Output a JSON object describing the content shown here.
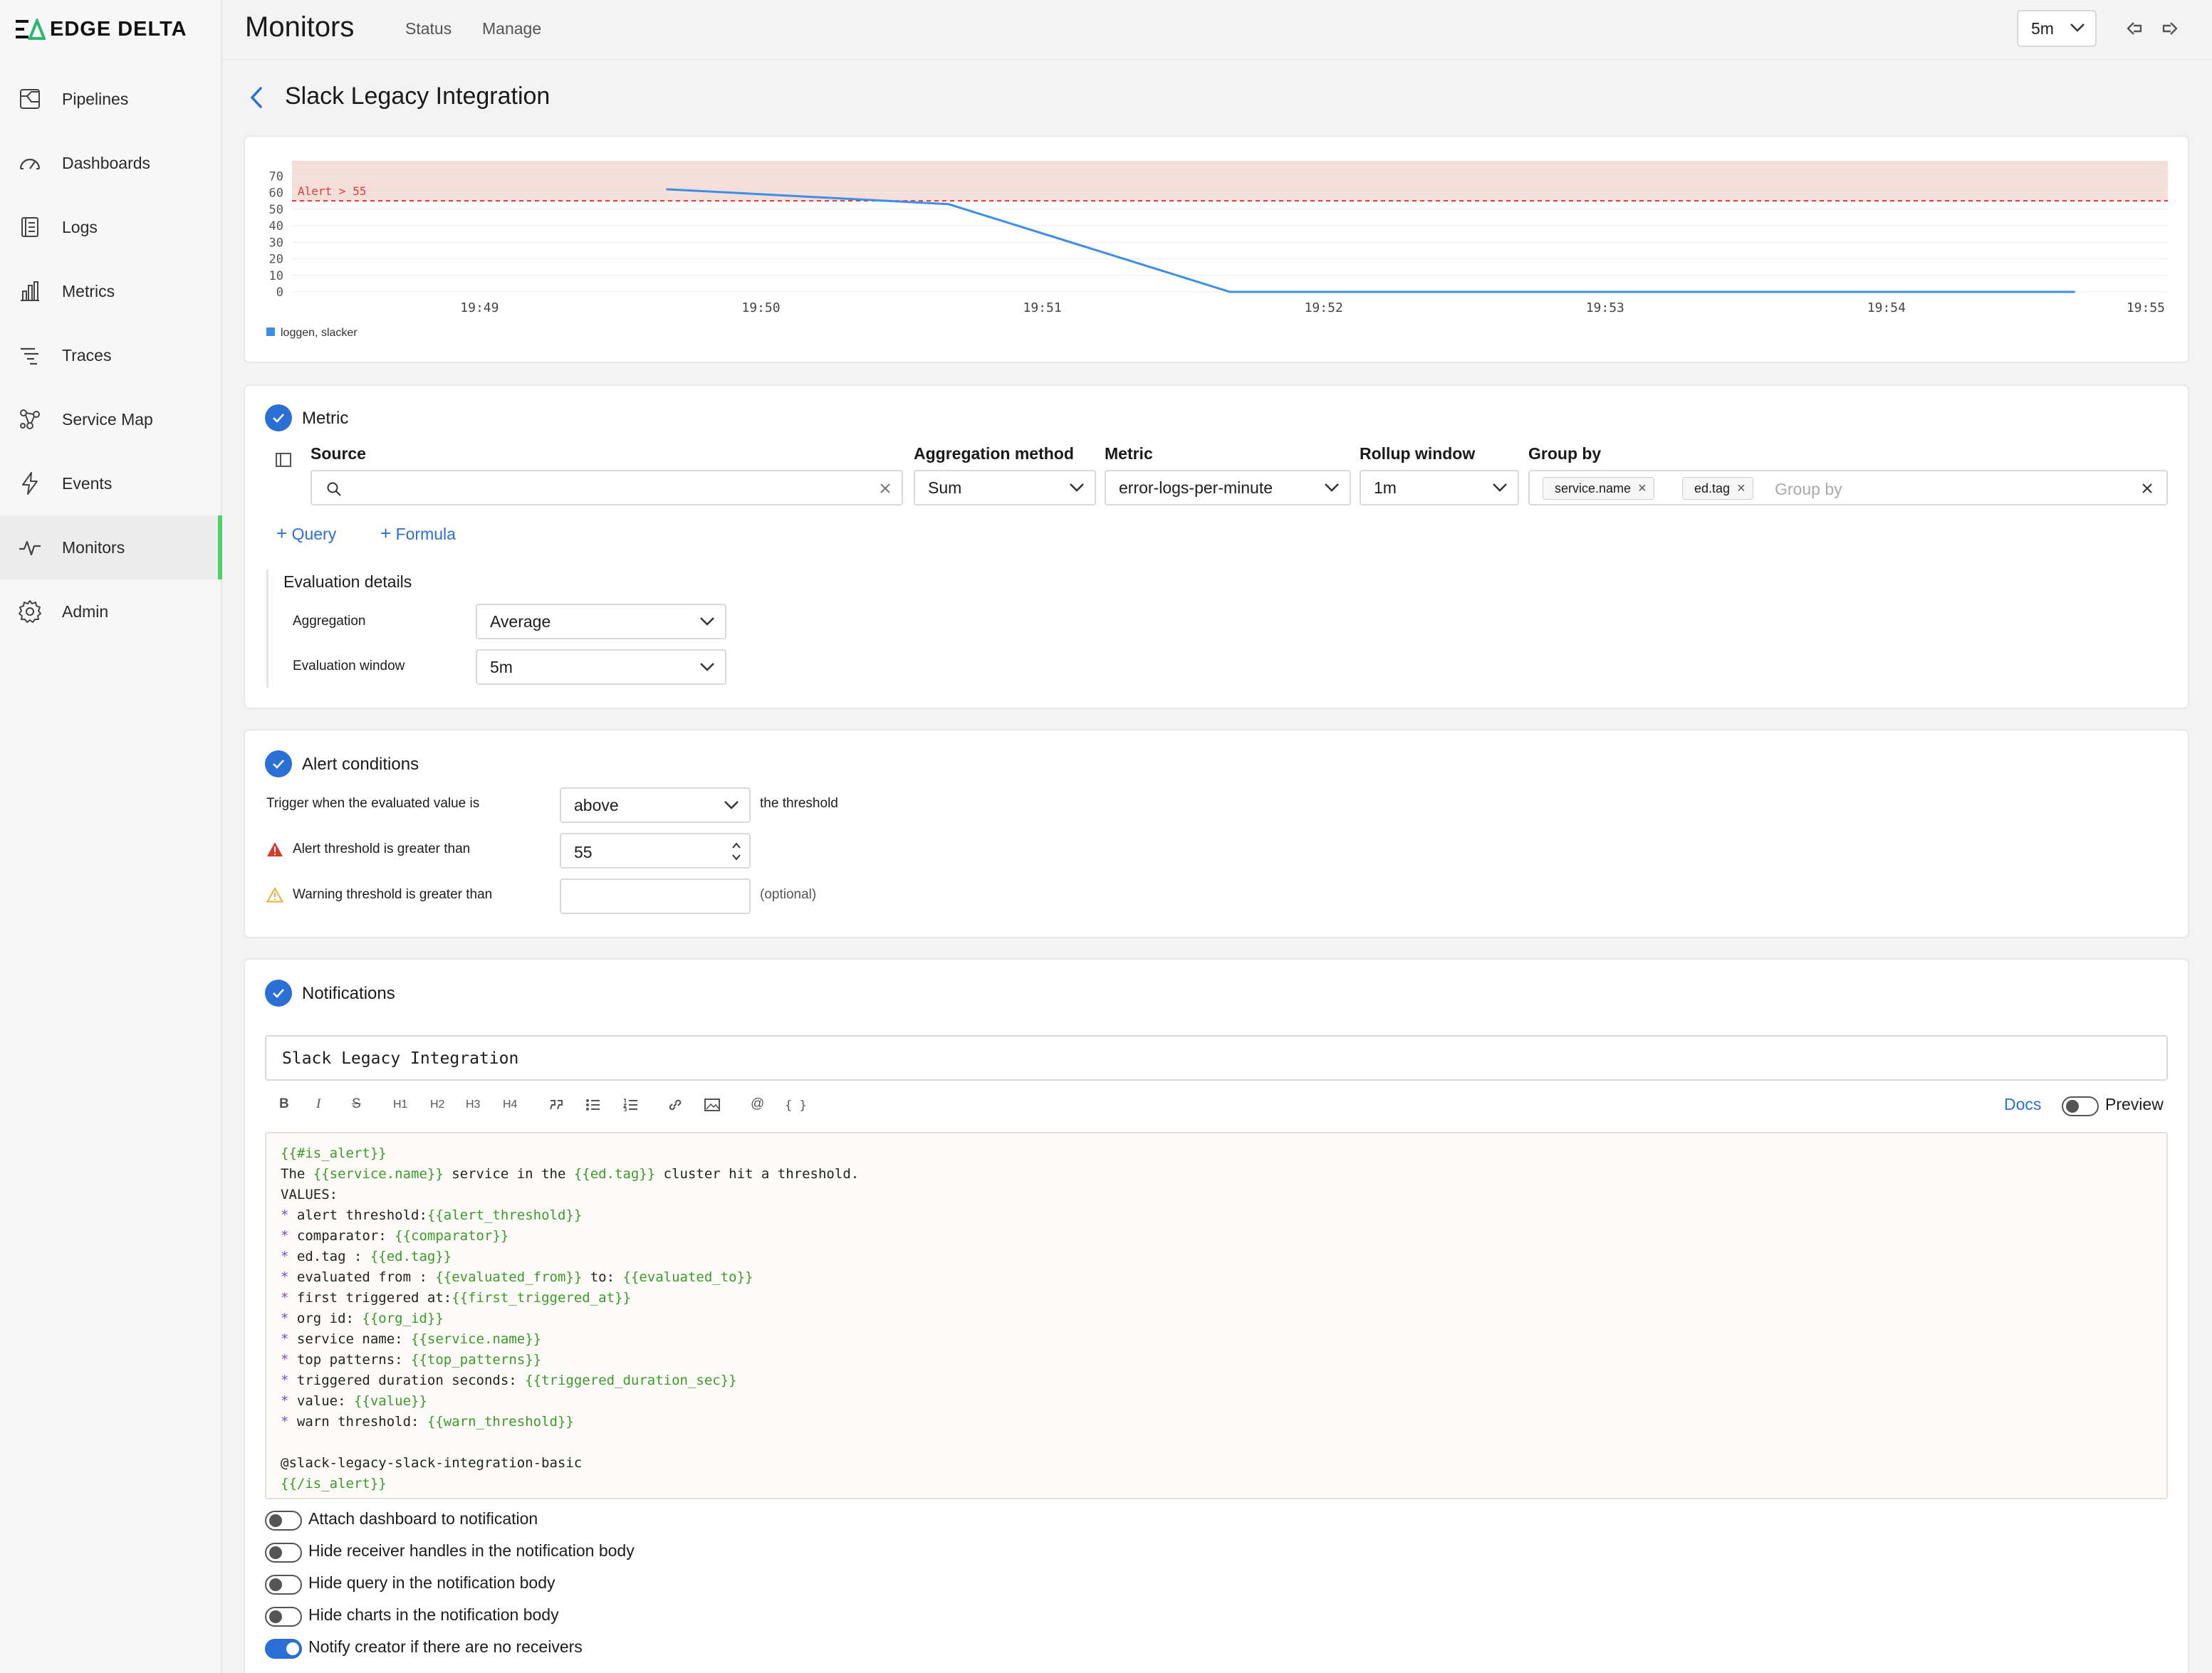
{
  "logo": {
    "text": "EDGE DELTA"
  },
  "sidebar": {
    "items": [
      {
        "label": "Pipelines",
        "icon": "pipelines-icon"
      },
      {
        "label": "Dashboards",
        "icon": "dashboards-icon"
      },
      {
        "label": "Logs",
        "icon": "logs-icon"
      },
      {
        "label": "Metrics",
        "icon": "metrics-icon"
      },
      {
        "label": "Traces",
        "icon": "traces-icon"
      },
      {
        "label": "Service Map",
        "icon": "service-map-icon"
      },
      {
        "label": "Events",
        "icon": "events-icon"
      },
      {
        "label": "Monitors",
        "icon": "monitors-icon",
        "active": true
      },
      {
        "label": "Admin",
        "icon": "admin-icon"
      }
    ],
    "accent": "#4fd26b"
  },
  "header": {
    "title": "Monitors",
    "tabs": [
      "Status",
      "Manage"
    ],
    "time_range": "5m"
  },
  "monitor": {
    "name": "Slack Legacy Integration"
  },
  "chart_data": {
    "type": "line",
    "x": [
      "19:48:40",
      "19:49:40",
      "19:50:40",
      "19:51:40",
      "19:52:40",
      "19:53:40",
      "19:54:40"
    ],
    "x_ticks": [
      "19:49",
      "19:50",
      "19:51",
      "19:52",
      "19:53",
      "19:54",
      "19:55"
    ],
    "series": [
      {
        "name": "loggen, slacker",
        "values": [
          null,
          62,
          53,
          0,
          0,
          0,
          0
        ],
        "color": "#3d8fe6"
      }
    ],
    "ylim": [
      0,
      80
    ],
    "y_ticks": [
      0,
      10,
      20,
      30,
      40,
      50,
      60,
      70
    ],
    "threshold": {
      "value": 55,
      "label": "Alert > 55",
      "color": "#d93b3b",
      "band_color": "#f5ddd8"
    },
    "grid": true,
    "legend": "bottom-left"
  },
  "metric": {
    "title": "Metric",
    "source_label": "Source",
    "source_value": "",
    "aggregation_method_label": "Aggregation method",
    "aggregation_method": "Sum",
    "metric_label": "Metric",
    "metric": "error-logs-per-minute",
    "rollup_label": "Rollup window",
    "rollup": "1m",
    "group_by_label": "Group by",
    "group_by_chips": [
      "service.name",
      "ed.tag"
    ],
    "group_by_placeholder": "Group by",
    "add_query": "Query",
    "add_formula": "Formula",
    "eval_title": "Evaluation details",
    "eval_aggregation_label": "Aggregation",
    "eval_aggregation": "Average",
    "eval_window_label": "Evaluation window",
    "eval_window": "5m"
  },
  "alert": {
    "title": "Alert conditions",
    "trigger_label": "Trigger when the evaluated value is",
    "trigger_value": "above",
    "trigger_suffix": "the threshold",
    "alert_label": "Alert threshold is greater than",
    "alert_value": "55",
    "warn_label": "Warning threshold is greater than",
    "warn_value": "",
    "warn_suffix": "(optional)"
  },
  "notifications": {
    "title": "Notifications",
    "subject": "Slack Legacy Integration",
    "toolbar": [
      "B",
      "I",
      "S",
      "H1",
      "H2",
      "H3",
      "H4",
      "quote",
      "bullet-list",
      "numbered-list",
      "link",
      "image",
      "@",
      "{ }"
    ],
    "docs": "Docs",
    "preview": "Preview",
    "body_lines": [
      [
        [
          "t",
          "{{#is_alert}}"
        ]
      ],
      [
        [
          "p",
          "The "
        ],
        [
          "t",
          "{{service.name}}"
        ],
        [
          "p",
          " service in the "
        ],
        [
          "t",
          "{{ed.tag}}"
        ],
        [
          "p",
          " cluster hit a threshold."
        ]
      ],
      [
        [
          "p",
          "VALUES:"
        ]
      ],
      [
        [
          "b",
          "* "
        ],
        [
          "p",
          "alert threshold:"
        ],
        [
          "t",
          "{{alert_threshold}}"
        ]
      ],
      [
        [
          "b",
          "* "
        ],
        [
          "p",
          "comparator: "
        ],
        [
          "t",
          "{{comparator}}"
        ]
      ],
      [
        [
          "b",
          "* "
        ],
        [
          "p",
          "ed.tag : "
        ],
        [
          "t",
          "{{ed.tag}}"
        ]
      ],
      [
        [
          "b",
          "* "
        ],
        [
          "p",
          "evaluated from : "
        ],
        [
          "t",
          "{{evaluated_from}}"
        ],
        [
          "p",
          " to: "
        ],
        [
          "t",
          "{{evaluated_to}}"
        ]
      ],
      [
        [
          "b",
          "* "
        ],
        [
          "p",
          "first triggered at:"
        ],
        [
          "t",
          "{{first_triggered_at}}"
        ]
      ],
      [
        [
          "b",
          "* "
        ],
        [
          "p",
          "org id: "
        ],
        [
          "t",
          "{{org_id}}"
        ]
      ],
      [
        [
          "b",
          "* "
        ],
        [
          "p",
          "service name: "
        ],
        [
          "t",
          "{{service.name}}"
        ]
      ],
      [
        [
          "b",
          "* "
        ],
        [
          "p",
          "top patterns: "
        ],
        [
          "t",
          "{{top_patterns}}"
        ]
      ],
      [
        [
          "b",
          "* "
        ],
        [
          "p",
          "triggered duration seconds: "
        ],
        [
          "t",
          "{{triggered_duration_sec}}"
        ]
      ],
      [
        [
          "b",
          "* "
        ],
        [
          "p",
          "value: "
        ],
        [
          "t",
          "{{value}}"
        ]
      ],
      [
        [
          "b",
          "* "
        ],
        [
          "p",
          "warn threshold: "
        ],
        [
          "t",
          "{{warn_threshold}}"
        ]
      ],
      [
        [
          "p",
          ""
        ]
      ],
      [
        [
          "p",
          "@slack-legacy-slack-integration-basic"
        ]
      ],
      [
        [
          "t",
          "{{/is_alert}}"
        ]
      ]
    ],
    "options": [
      {
        "label": "Attach dashboard to notification",
        "on": false
      },
      {
        "label": "Hide receiver handles in the notification body",
        "on": false
      },
      {
        "label": "Hide query in the notification body",
        "on": false
      },
      {
        "label": "Hide charts in the notification body",
        "on": false
      },
      {
        "label": "Notify creator if there are no receivers",
        "on": true
      }
    ]
  }
}
